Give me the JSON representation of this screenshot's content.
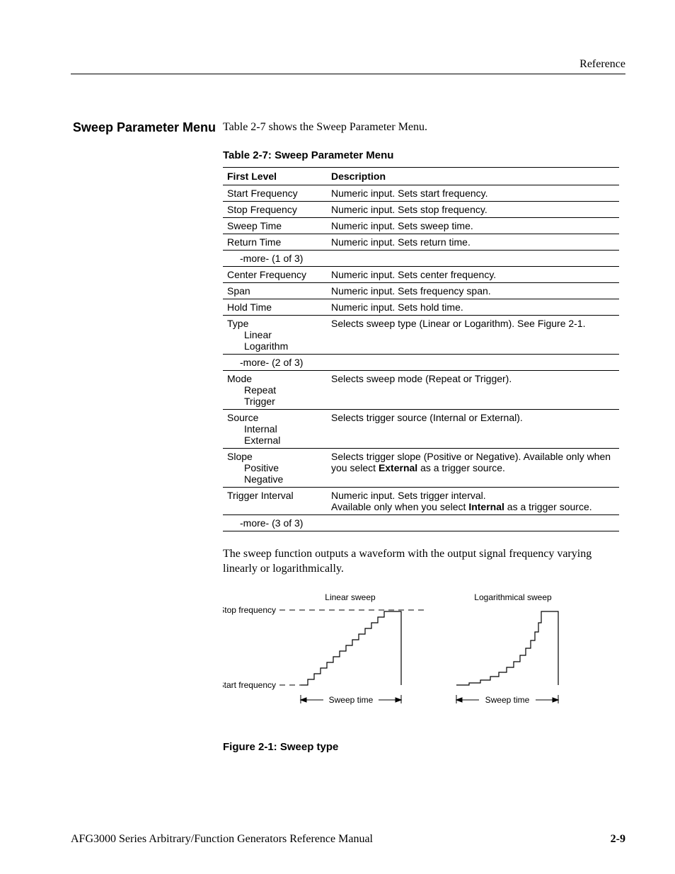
{
  "header": {
    "running_head": "Reference"
  },
  "section": {
    "title": "Sweep Parameter Menu",
    "intro": "Table 2-7 shows the Sweep Parameter Menu."
  },
  "table": {
    "caption": "Table 2-7: Sweep Parameter Menu",
    "col1": "First Level",
    "col2": "Description",
    "rows": [
      {
        "first": "Start Frequency",
        "desc": "Numeric input. Sets start frequency."
      },
      {
        "first": "Stop Frequency",
        "desc": "Numeric input. Sets stop frequency."
      },
      {
        "first": "Sweep Time",
        "desc": "Numeric input. Sets sweep time."
      },
      {
        "first": "Return Time",
        "desc": "Numeric input. Sets return time."
      },
      {
        "first_indent": "-more- (1 of 3)",
        "desc": ""
      },
      {
        "first": "Center Frequency",
        "desc": "Numeric input. Sets center frequency."
      },
      {
        "first": "Span",
        "desc": "Numeric input. Sets frequency span."
      },
      {
        "first": "Hold Time",
        "desc": "Numeric input. Sets hold time."
      },
      {
        "first": "Type",
        "sub": [
          "Linear",
          "Logarithm"
        ],
        "desc": "Selects sweep type (Linear or Logarithm). See Figure 2-1."
      },
      {
        "first_indent": "-more- (2 of 3)",
        "desc": ""
      },
      {
        "first": "Mode",
        "sub": [
          "Repeat",
          "Trigger"
        ],
        "desc": "Selects sweep mode (Repeat or Trigger)."
      },
      {
        "first": "Source",
        "sub": [
          "Internal",
          "External"
        ],
        "desc": "Selects trigger source (Internal or External)."
      },
      {
        "first": "Slope",
        "sub": [
          "Positive",
          "Negative"
        ],
        "desc_pre": "Selects trigger slope (Positive or Negative). Available only when you select ",
        "desc_bold": "External",
        "desc_post": " as a trigger source."
      },
      {
        "first": "Trigger Interval",
        "desc_line1": "Numeric input. Sets trigger interval.",
        "desc_pre": "Available only when you select ",
        "desc_bold": "Internal",
        "desc_post": " as a trigger source."
      },
      {
        "first_indent": "-more- (3 of 3)",
        "desc": ""
      }
    ]
  },
  "after_table_para": "The sweep function outputs a waveform with the output signal frequency varying linearly or logarithmically.",
  "figure": {
    "caption": "Figure 2-1: Sweep type",
    "labels": {
      "linear_title": "Linear sweep",
      "log_title": "Logarithmical sweep",
      "stop_freq": "Stop frequency",
      "start_freq": "Start frequency",
      "sweep_time": "Sweep time"
    }
  },
  "footer": {
    "left": "AFG3000 Series Arbitrary/Function Generators Reference Manual",
    "page": "2-9"
  }
}
